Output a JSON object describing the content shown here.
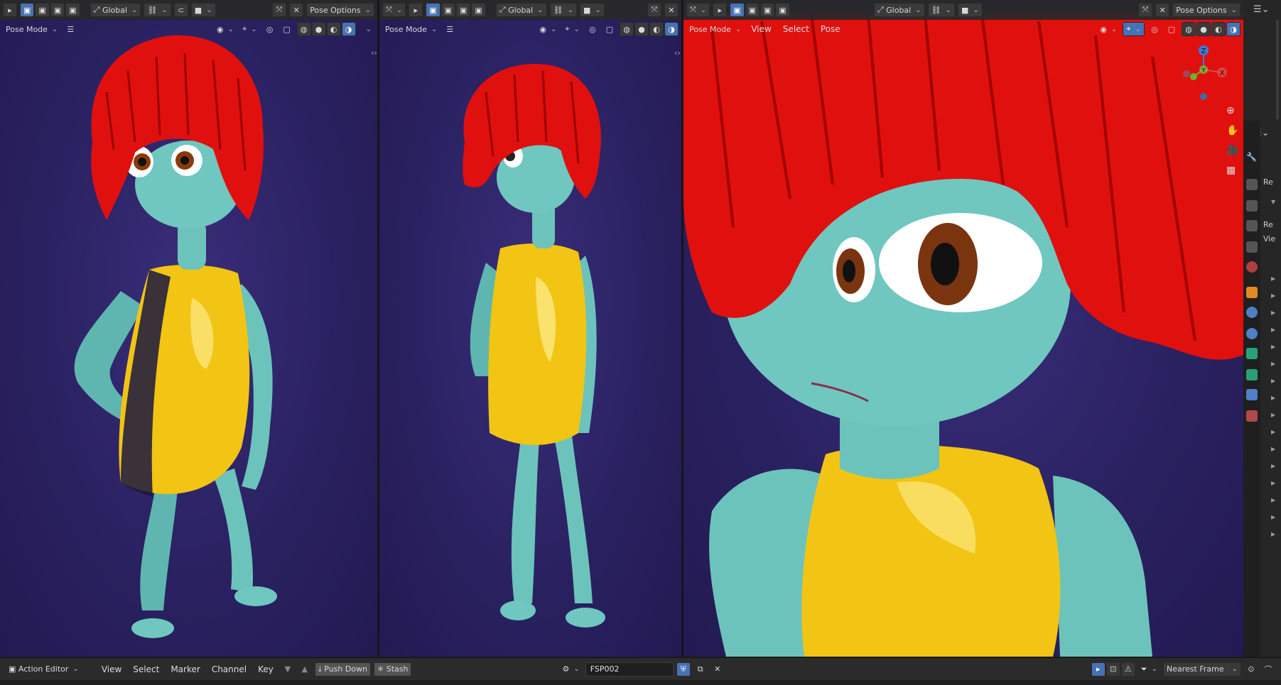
{
  "colors": {
    "accent": "#4772b3",
    "viewport_bg": "#2a2060",
    "header_bg": "#282828",
    "skin": "#6fc7bf",
    "hair": "#e0100f",
    "dress": "#f2c414"
  },
  "viewport_left": {
    "transform_orientation": "Global",
    "pose_options": "Pose Options",
    "mode": "Pose Mode"
  },
  "viewport_middle": {
    "transform_orientation": "Global",
    "mode": "Pose Mode"
  },
  "viewport_right": {
    "transform_orientation": "Global",
    "pose_options": "Pose Options",
    "mode": "Pose Mode",
    "menus": [
      "View",
      "Select",
      "Pose"
    ],
    "gizmo_axes": [
      "Z",
      "Y",
      "X"
    ]
  },
  "properties_panel": {
    "texts": [
      "Re",
      "Re",
      "Vie"
    ]
  },
  "dopesheet": {
    "editor_type": "Action Editor",
    "menus": [
      "View",
      "Select",
      "Marker",
      "Channel",
      "Key"
    ],
    "push_down": "Push Down",
    "stash": "Stash",
    "action_name": "FSP002",
    "snapping": "Nearest Frame"
  }
}
